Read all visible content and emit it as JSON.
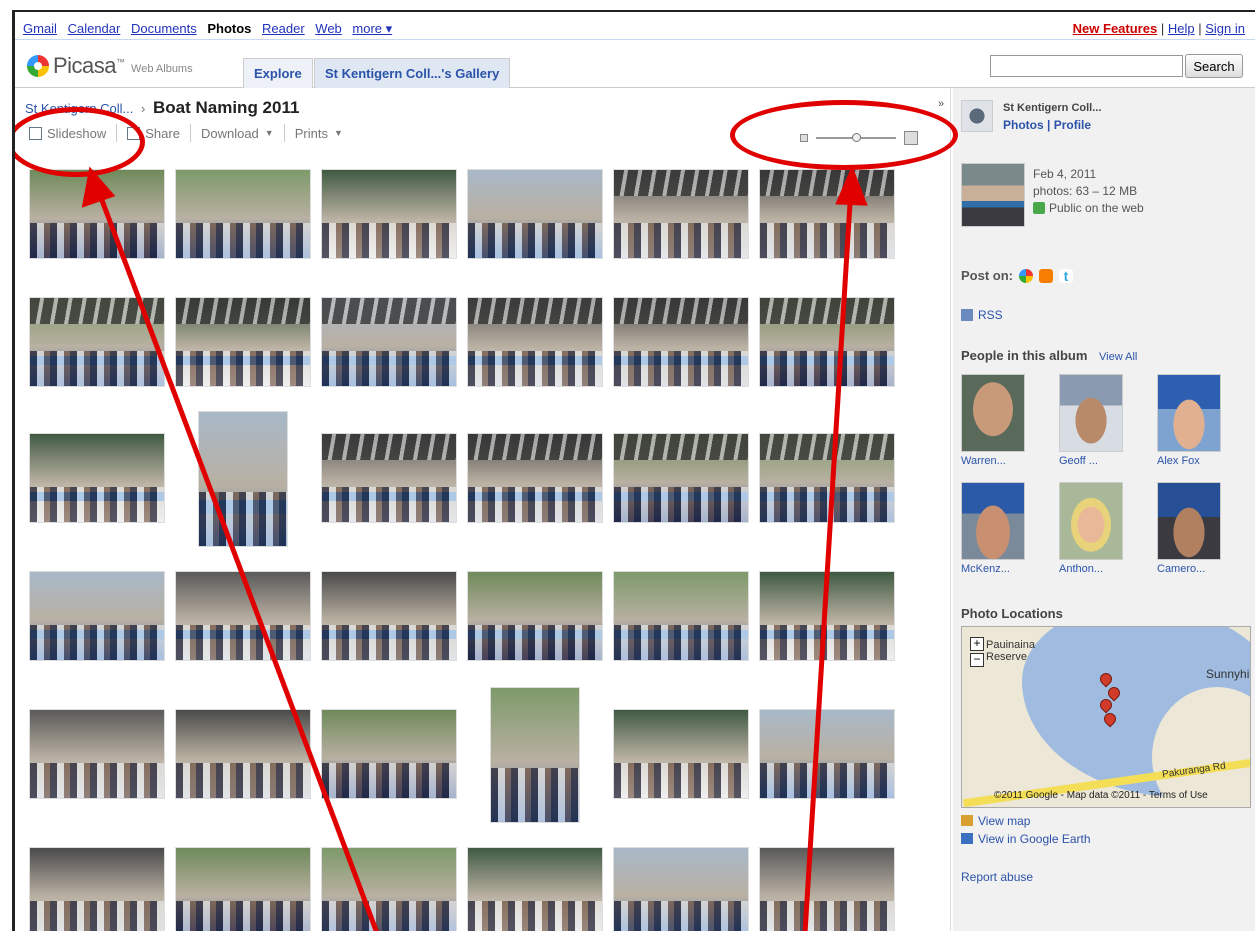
{
  "topbar": {
    "nav": [
      "Gmail",
      "Calendar",
      "Documents",
      "Photos",
      "Reader",
      "Web",
      "more ▾"
    ],
    "active": "Photos",
    "new_features": "New Features",
    "help": "Help",
    "sign_in": "Sign in",
    "sep": "|"
  },
  "header": {
    "logo_text": "Picasa",
    "logo_tm": "™",
    "logo_sub": "Web Albums",
    "tab_explore": "Explore",
    "tab_gallery": "St Kentigern Coll...'s Gallery",
    "search_value": "",
    "search_button": "Search"
  },
  "album": {
    "breadcrumb": "St Kentigern Coll...",
    "breadcrumb_sep": "›",
    "title": "Boat Naming 2011",
    "actions": {
      "slideshow": "Slideshow",
      "share": "Share",
      "download": "Download",
      "prints": "Prints"
    }
  },
  "sidebar": {
    "collapse_arrow": "»",
    "owner_name": "St Kentigern Coll...",
    "owner_photos": "Photos",
    "owner_profile": "Profile",
    "owner_sep": "|",
    "date": "Feb 4, 2011",
    "photos_count": "photos: 63 – 12 MB",
    "visibility": "Public on the web",
    "post_on": "Post on:",
    "rss": "RSS",
    "people_heading": "People in this album",
    "view_all": "View All",
    "people": [
      "Warren...",
      "Geoff ...",
      "Alex Fox",
      "McKenz...",
      "Anthon...",
      "Camero..."
    ],
    "locations_heading": "Photo Locations",
    "map": {
      "place_1": "Pauinaina",
      "place_2": "Reserve",
      "place_3": "Sunnyhil",
      "place_4": "Pakuranga Rd",
      "copyright": "©2011 Google - Map data ©2011 - Terms of Use",
      "zoom_in": "+",
      "zoom_out": "−"
    },
    "view_map": "View map",
    "view_earth": "View in Google Earth",
    "report_abuse": "Report abuse"
  },
  "colors": {
    "link": "#2a53a9",
    "annotation": "#e00000",
    "new_features": "#cc0000"
  }
}
